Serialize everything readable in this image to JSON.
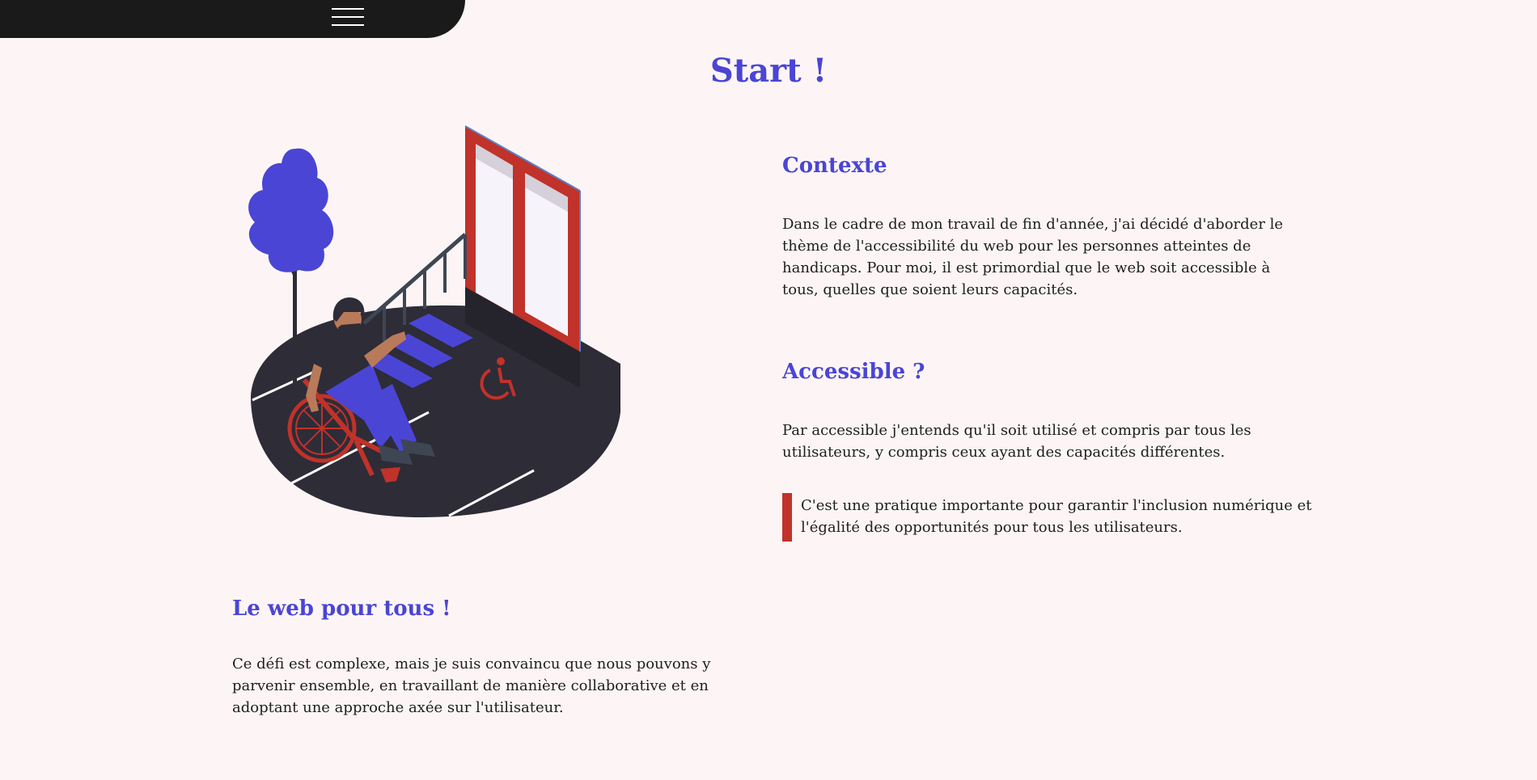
{
  "nav": {
    "menu_icon": "hamburger-menu-icon"
  },
  "main": {
    "title": "Start !",
    "illustration": "wheelchair-ramp-illustration",
    "sections": {
      "contexte": {
        "heading": "Contexte",
        "text": "Dans le cadre de mon travail de fin d'année, j'ai décidé d'aborder le thème de l'accessibilité du web pour les personnes atteintes de handicaps. Pour moi, il est primordial que le web soit accessible à tous, quelles que soient leurs capacités."
      },
      "accessible": {
        "heading": "Accessible ?",
        "text": "Par accessible j'entends qu'il soit utilisé et compris par tous les utilisateurs, y compris ceux ayant des capacités différentes.",
        "quote": "C'est une pratique importante pour garantir l'inclusion numérique et l'égalité des opportunités pour tous les utilisateurs."
      },
      "web": {
        "heading": "Le web pour tous !",
        "text": "Ce défi est complexe, mais je suis convaincu que nous pouvons y parvenir ensemble, en travaillant de manière collaborative et en adoptant une approche axée sur l'utilisateur."
      }
    }
  },
  "colors": {
    "accent": "#4a45d5",
    "red": "#c0322a",
    "dark": "#1a1a1a",
    "background": "#fdf5f5"
  }
}
